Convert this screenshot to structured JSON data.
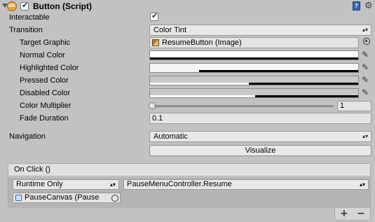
{
  "component": {
    "title": "Button (Script)",
    "script_badge": "OK",
    "enabled": true
  },
  "props": {
    "interactable_label": "Interactable",
    "interactable_checked": true,
    "transition_label": "Transition",
    "transition_value": "Color Tint",
    "target_graphic_label": "Target Graphic",
    "target_graphic_value": "ResumeButton (Image)",
    "normal_color_label": "Normal Color",
    "highlighted_color_label": "Highlighted Color",
    "pressed_color_label": "Pressed Color",
    "disabled_color_label": "Disabled Color",
    "color_multiplier_label": "Color Multiplier",
    "color_multiplier_value": "1",
    "fade_duration_label": "Fade Duration",
    "fade_duration_value": "0.1",
    "navigation_label": "Navigation",
    "navigation_value": "Automatic",
    "visualize_label": "Visualize"
  },
  "colors": {
    "normal": "#ffffff",
    "highlighted": "#f5f5f5",
    "pressed": "#c8c8c8",
    "disabled": "#c8c8c8",
    "normal_alpha": 1.0,
    "highlighted_alpha": 0.22,
    "pressed_alpha": 0.5,
    "disabled_alpha": 0.5
  },
  "onclick": {
    "header": "On Click ()",
    "runtime_value": "Runtime Only",
    "function_value": "PauseMenuController.Resume",
    "target_value": "PauseCanvas (Pause"
  },
  "footer": {
    "add_label": "+",
    "remove_label": "−"
  }
}
